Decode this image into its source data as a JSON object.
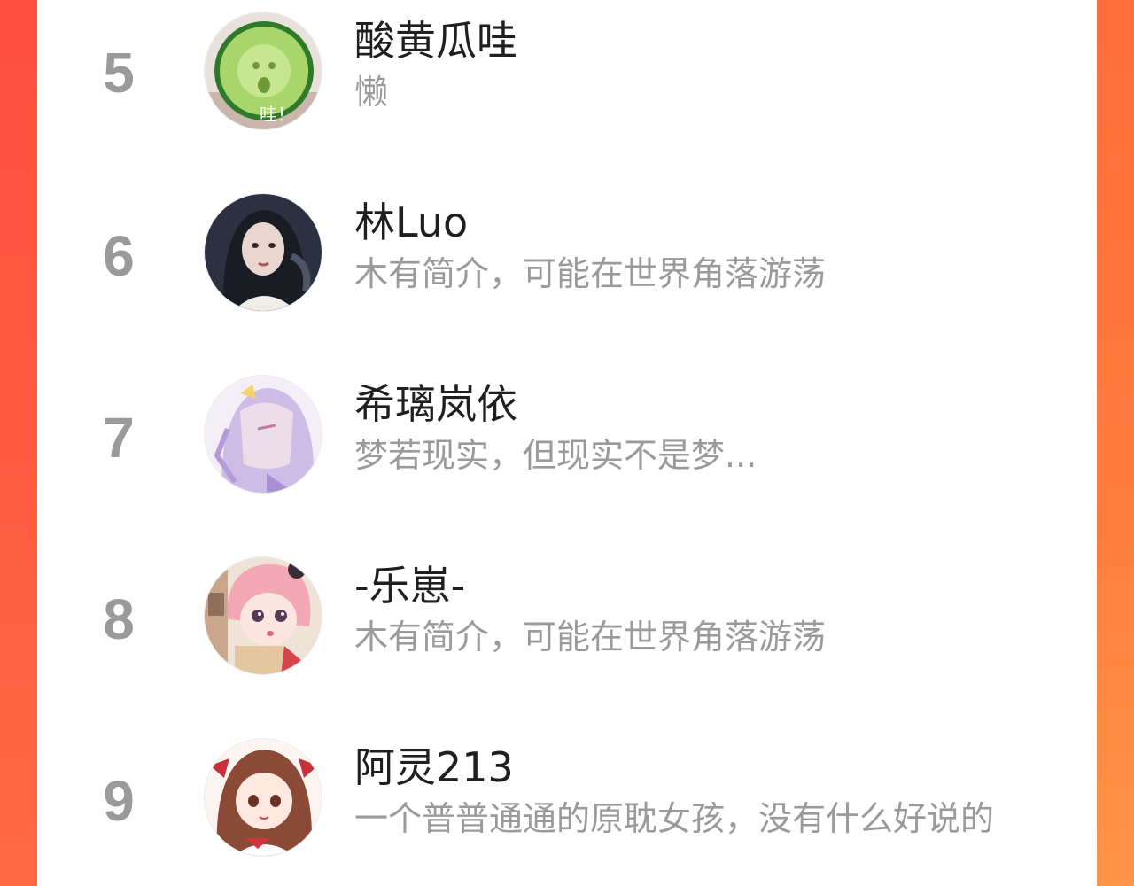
{
  "colors": {
    "accent_left": "#ff4f3f",
    "accent_right": "#ff7e3c",
    "rank_gray": "#9a9a9a",
    "name_text": "#1f1f1f",
    "bio_text": "#9a9a9a"
  },
  "list": {
    "items": [
      {
        "rank": "5",
        "name": "酸黄瓜哇",
        "bio": "懒",
        "avatar_icon": "cucumber-avatar",
        "avatar_text": "哇！"
      },
      {
        "rank": "6",
        "name": "林Luo",
        "bio": "木有简介，可能在世界角落游荡",
        "avatar_icon": "dark-hair-girl-avatar"
      },
      {
        "rank": "7",
        "name": "希璃岚依",
        "bio": "梦若现实，但现实不是梦...",
        "avatar_icon": "anime-lilac-hair-avatar"
      },
      {
        "rank": "8",
        "name": "-乐崽-",
        "bio": "木有简介，可能在世界角落游荡",
        "avatar_icon": "anime-pink-hair-avatar"
      },
      {
        "rank": "9",
        "name": "阿灵213",
        "bio": "一个普普通通的原耽女孩，没有什么好说的",
        "avatar_icon": "anime-brown-hair-avatar"
      }
    ]
  }
}
